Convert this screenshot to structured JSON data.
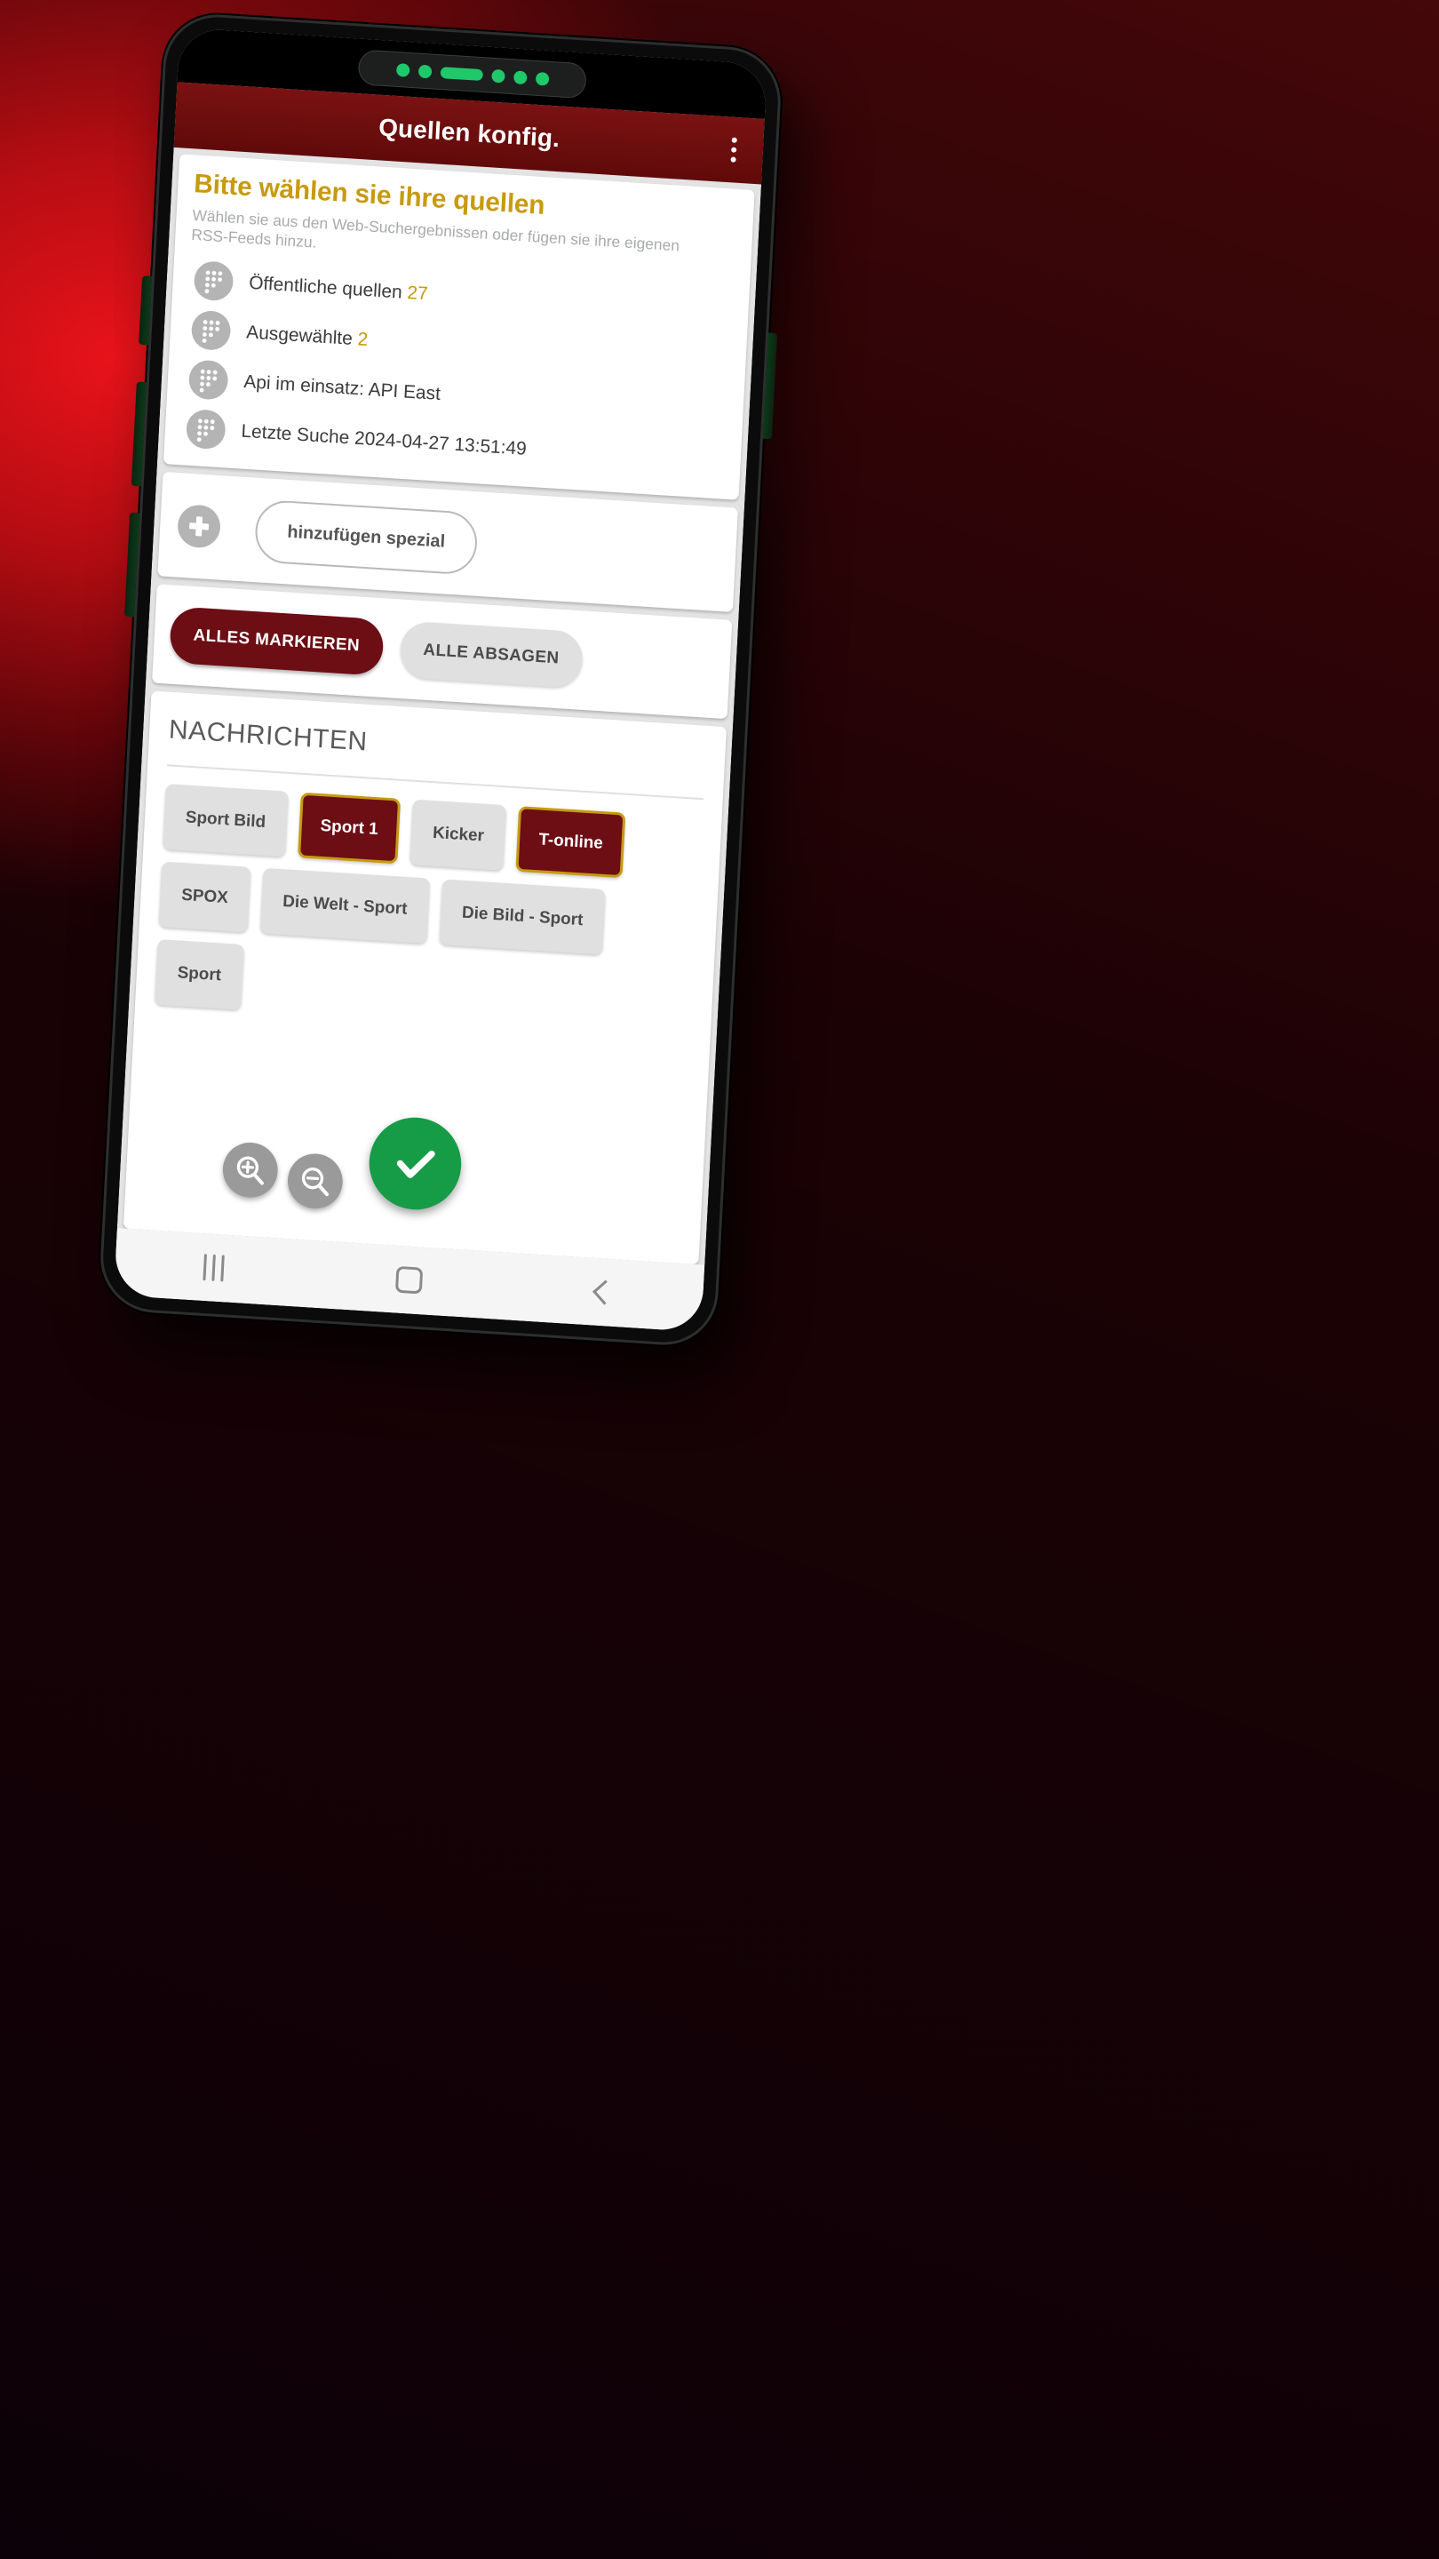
{
  "appbar": {
    "title": "Quellen konfig.",
    "overflow_icon": "more-vert-icon"
  },
  "info_card": {
    "headline": "Bitte wählen sie ihre quellen",
    "subhead": "Wählen sie aus den Web-Suchergebnissen oder fügen sie ihre eigenen RSS-Feeds hinzu.",
    "rows": [
      {
        "icon": "braille-dots-icon",
        "label": "Öffentliche quellen",
        "value": "27"
      },
      {
        "icon": "braille-dots-icon",
        "label": "Ausgewählte",
        "value": "2"
      },
      {
        "icon": "braille-dots-icon",
        "label": "Api im einsatz: API East",
        "value": ""
      },
      {
        "icon": "braille-dots-icon",
        "label": "Letzte Suche 2024-04-27 13:51:49",
        "value": ""
      }
    ]
  },
  "add_card": {
    "plus_icon": "plus-circle-icon",
    "button_label": "hinzufügen spezial"
  },
  "bulk_card": {
    "select_all_label": "ALLES MARKIEREN",
    "deselect_all_label": "ALLE ABSAGEN"
  },
  "sources_card": {
    "title": "NACHRICHTEN",
    "chips": [
      {
        "label": "Sport Bild",
        "selected": false
      },
      {
        "label": "Sport 1",
        "selected": true
      },
      {
        "label": "Kicker",
        "selected": false
      },
      {
        "label": "T-online",
        "selected": true
      },
      {
        "label": "SPOX",
        "selected": false
      },
      {
        "label": "Die Welt - Sport",
        "selected": false
      },
      {
        "label": "Die Bild - Sport",
        "selected": false
      },
      {
        "label": "Sport",
        "selected": false
      }
    ]
  },
  "floating": {
    "zoom_in_icon": "zoom-in-icon",
    "zoom_out_icon": "zoom-out-icon",
    "confirm_icon": "check-icon"
  },
  "navbar": {
    "recents_icon": "recents-icon",
    "home_icon": "home-square-icon",
    "back_icon": "back-chevron-icon"
  },
  "colors": {
    "brand_dark_red": "#6d0d14",
    "appbar_red": "#6d0d0d",
    "accent_gold": "#c79a10",
    "confirm_green": "#169c46",
    "chip_off_bg": "#e0e0e0"
  }
}
